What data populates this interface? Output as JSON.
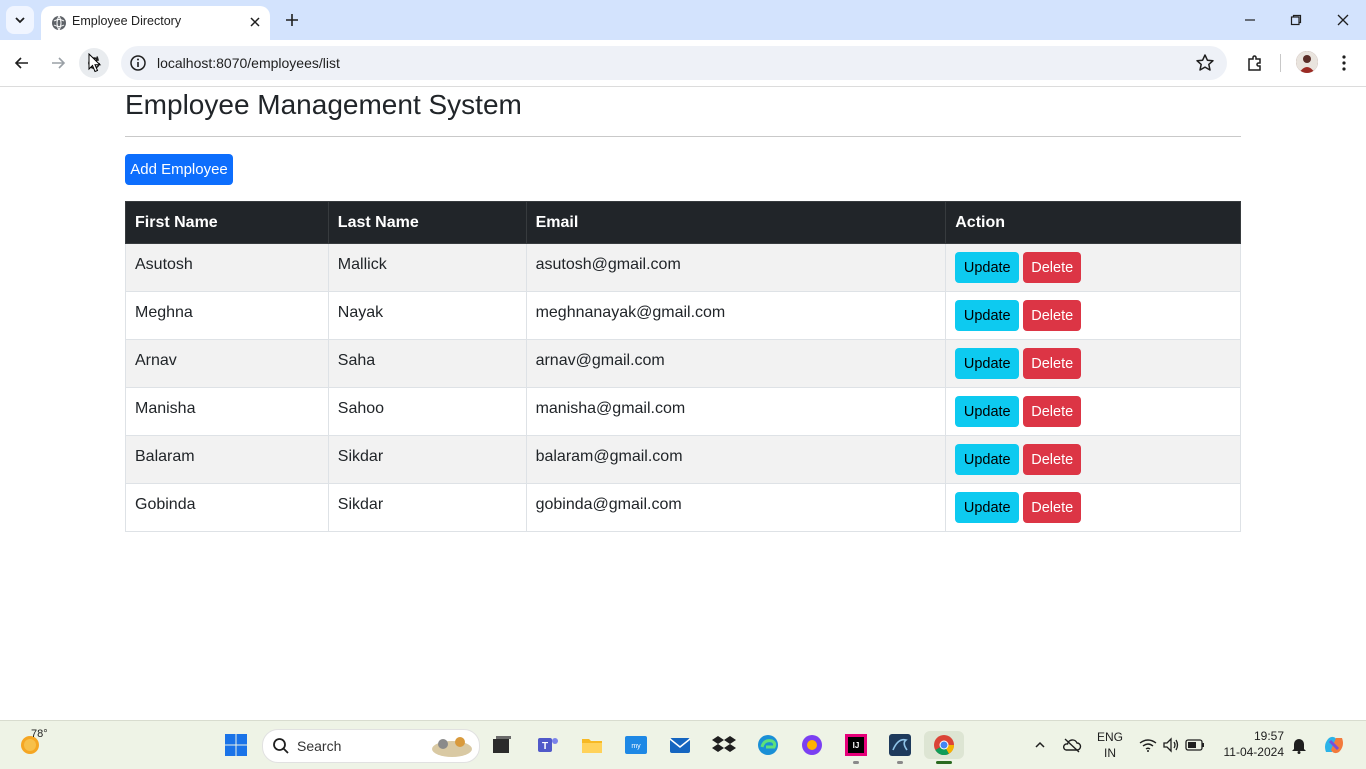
{
  "browser": {
    "tab_title": "Employee Directory",
    "url": "localhost:8070/employees/list"
  },
  "page": {
    "heading": "Employee Management System",
    "add_button": "Add Employee",
    "columns": [
      "First Name",
      "Last Name",
      "Email",
      "Action"
    ],
    "rows": [
      {
        "first": "Asutosh",
        "last": "Mallick",
        "email": "asutosh@gmail.com"
      },
      {
        "first": "Meghna",
        "last": "Nayak",
        "email": "meghnanayak@gmail.com"
      },
      {
        "first": "Arnav",
        "last": "Saha",
        "email": "arnav@gmail.com"
      },
      {
        "first": "Manisha",
        "last": "Sahoo",
        "email": "manisha@gmail.com"
      },
      {
        "first": "Balaram",
        "last": "Sikdar",
        "email": "balaram@gmail.com"
      },
      {
        "first": "Gobinda",
        "last": "Sikdar",
        "email": "gobinda@gmail.com"
      }
    ],
    "update_label": "Update",
    "delete_label": "Delete"
  },
  "taskbar": {
    "weather_temp": "78°",
    "search_placeholder": "Search",
    "lang_line1": "ENG",
    "lang_line2": "IN",
    "time": "19:57",
    "date": "11-04-2024"
  },
  "colors": {
    "primary": "#0d6efd",
    "info": "#0dcaf0",
    "danger": "#dc3545",
    "table_header": "#212529",
    "tab_strip": "#d3e3fd"
  }
}
